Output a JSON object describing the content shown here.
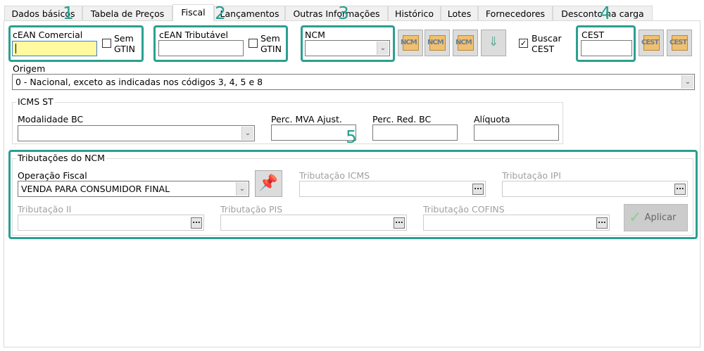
{
  "tabs": [
    "Dados básicos",
    "Tabela de Preços",
    "Fiscal",
    "Lançamentos",
    "Outras Informações",
    "Histórico",
    "Lotes",
    "Fornecedores",
    "Desconto na carga"
  ],
  "active_tab": "Fiscal",
  "annotations": [
    "1",
    "2",
    "3",
    "4",
    "5"
  ],
  "cean_comercial": {
    "label": "cEAN Comercial",
    "value": "",
    "sem_gtin": [
      "Sem",
      "GTIN"
    ],
    "checked": false
  },
  "cean_tributavel": {
    "label": "cEAN Tributável",
    "value": "",
    "sem_gtin": [
      "Sem",
      "GTIN"
    ],
    "checked": false
  },
  "ncm": {
    "label": "NCM",
    "value": "",
    "buttons": [
      "ncm-new-icon",
      "ncm-search-icon",
      "ncm-table-icon",
      "cart-download-search-icon"
    ],
    "btn_text": "NCM"
  },
  "buscar_cest": {
    "label": [
      "Buscar",
      "CEST"
    ],
    "checked": true
  },
  "cest": {
    "label": "CEST",
    "value": "",
    "btn_text": "CEST"
  },
  "origem": {
    "label": "Origem",
    "value": "0 - Nacional, exceto as indicadas nos códigos 3, 4, 5 e 8"
  },
  "icms_st": {
    "title": "ICMS ST",
    "modalidade_label": "Modalidade BC",
    "modalidade_value": "",
    "mva_label": "Perc. MVA Ajust.",
    "red_label": "Perc. Red. BC",
    "aliquota_label": "Alíquota"
  },
  "trib_ncm": {
    "title": "Tributações do NCM",
    "operacao_label": "Operação Fiscal",
    "operacao_value": "VENDA PARA CONSUMIDOR FINAL",
    "icms_label": "Tributação ICMS",
    "ipi_label": "Tributação IPI",
    "ii_label": "Tributação II",
    "pis_label": "Tributação PIS",
    "cofins_label": "Tributação COFINS",
    "aplicar": "Aplicar",
    "dots": "..."
  },
  "accent": "#2aa090"
}
